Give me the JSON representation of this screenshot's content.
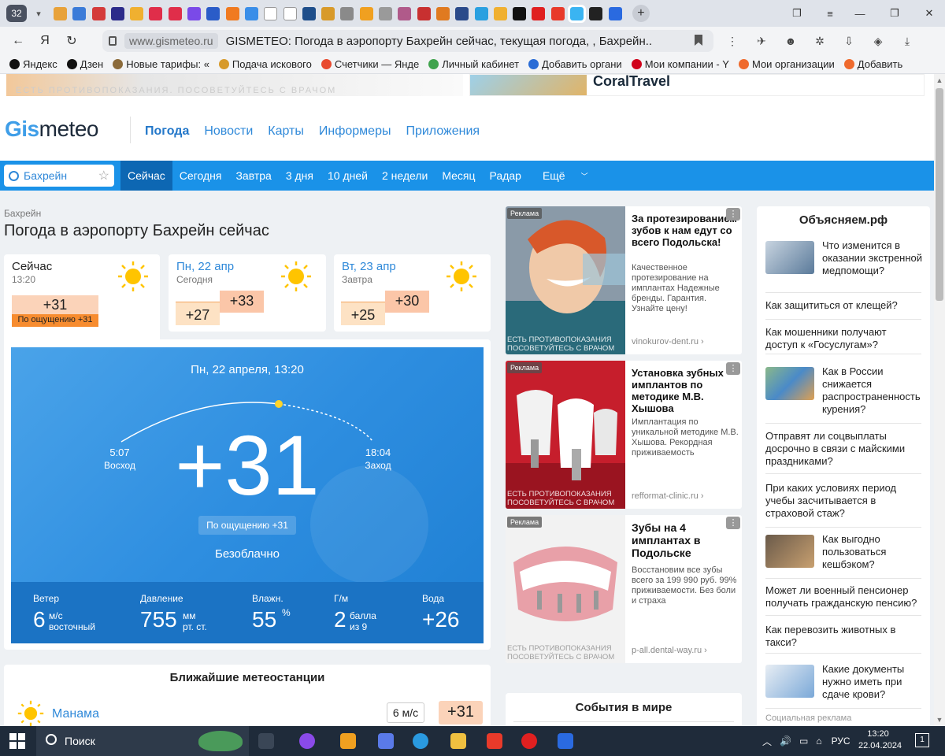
{
  "browser": {
    "tab_count": "32",
    "url_domain": "www.gismeteo.ru",
    "page_title": "GISMETEO: Погода в аэропорту Бахрейн сейчас, текущая погода, , Бахрейн...",
    "bookmarks": [
      {
        "label": "Яндекс",
        "color": "#111111"
      },
      {
        "label": "Дзен",
        "color": "#111111"
      },
      {
        "label": "Новые тарифы: «",
        "color": "#8b6a3a"
      },
      {
        "label": "Подача искового",
        "color": "#d79a2b"
      },
      {
        "label": "Счетчики — Янде",
        "color": "#e84a2f"
      },
      {
        "label": "Личный кабинет",
        "color": "#3fa34d"
      },
      {
        "label": "Добавить органи",
        "color": "#2a6cd6"
      },
      {
        "label": "Мои компании - Y",
        "color": "#d0021b"
      },
      {
        "label": "Мои организации",
        "color": "#ef6a2d"
      },
      {
        "label": "Добавить",
        "color": "#ef6a2d"
      }
    ]
  },
  "top_ad": {
    "left_disclaimer": "ЕСТЬ ПРОТИВОПОКАЗАНИЯ. ПОСОВЕТУЙТЕСЬ С ВРАЧОМ",
    "right_brand": "CoralTravel"
  },
  "header": {
    "logo_accent": "Gis",
    "logo_rest": "meteo",
    "nav": [
      "Погода",
      "Новости",
      "Карты",
      "Информеры",
      "Приложения"
    ]
  },
  "subnav": {
    "search_value": "Бахрейн",
    "items": [
      "Сейчас",
      "Сегодня",
      "Завтра",
      "3 дня",
      "10 дней",
      "2 недели",
      "Месяц",
      "Радар",
      "Ещё"
    ]
  },
  "page": {
    "breadcrumb": "Бахрейн",
    "title": "Погода в аэропорту Бахрейн сейчас"
  },
  "cards": {
    "now": {
      "title": "Сейчас",
      "time": "13:20",
      "temp": "+31",
      "feels": "По ощущению +31"
    },
    "today": {
      "title": "Пн, 22 апр",
      "sub": "Сегодня",
      "low": "+27",
      "high": "+33"
    },
    "tomorrow": {
      "title": "Вт, 23 апр",
      "sub": "Завтра",
      "low": "+25",
      "high": "+30"
    }
  },
  "current": {
    "datetime": "Пн, 22 апреля, 13:20",
    "sunrise_time": "5:07",
    "sunrise_label": "Восход",
    "sunset_time": "18:04",
    "sunset_label": "Заход",
    "temp": "+31",
    "feels": "По ощущению +31",
    "condition": "Безоблачно",
    "stats": {
      "wind_label": "Ветер",
      "wind_value": "6",
      "wind_unit": "м/с",
      "wind_dir": "восточный",
      "pressure_label": "Давление",
      "pressure_value": "755",
      "pressure_unit": "мм",
      "pressure_unit2": "рт. ст.",
      "humidity_label": "Влажн.",
      "humidity_value": "55",
      "humidity_unit": "%",
      "geo_label": "Г/м",
      "geo_value": "2",
      "geo_unit": "балла",
      "geo_unit2": "из 9",
      "water_label": "Вода",
      "water_value": "+26"
    }
  },
  "stations": {
    "title": "Ближайшие метеостанции",
    "first_name": "Манама",
    "first_wind": "6 м/с",
    "first_temp": "+31"
  },
  "ads": [
    {
      "label": "Реклама",
      "title": "За протезированием зубов к нам едут со всего Подольска!",
      "body": "Качественное протезирование на имплантах Надежные бренды. Гарантия. Узнайте цену!",
      "domain": "vinokurov-dent.ru ›",
      "warning": "ЕСТЬ ПРОТИВОПОКАЗАНИЯ ПОСОВЕТУЙТЕСЬ С ВРАЧОМ"
    },
    {
      "label": "Реклама",
      "title": "Установка зубных имплантов по методике М.В. Хышова",
      "body": "Имплантация по уникальной методике М.В. Хышова. Рекордная приживаемость",
      "domain": "refformat-clinic.ru ›",
      "warning": "ЕСТЬ ПРОТИВОПОКАЗАНИЯ ПОСОВЕТУЙТЕСЬ С ВРАЧОМ"
    },
    {
      "label": "Реклама",
      "title": "Зубы на 4 имплантах в Подольске",
      "body": "Восстановим все зубы всего за 199 990 руб. 99% приживаемости. Без боли и страха",
      "domain": "p-all.dental-way.ru ›",
      "warning": "ЕСТЬ ПРОТИВОПОКАЗАНИЯ ПОСОВЕТУЙТЕСЬ С ВРАЧОМ"
    }
  ],
  "events": {
    "title": "События в мире"
  },
  "explain": {
    "title": "Объясняем.рф",
    "items": [
      "Что изменится в оказании экстренной медпомощи?",
      "Как защититься от клещей?",
      "Как мошенники получают доступ к «Госуслугам»?",
      "Как в России снижается распространенность курения?",
      "Отправят ли соцвыплаты досрочно в связи с майскими праздниками?",
      "При каких условиях период учебы засчитывается в страховой стаж?",
      "Как выгодно пользоваться кешбэком?",
      "Может ли военный пенсионер получать гражданскую пенсию?",
      "Как перевозить животных в такси?",
      "Какие документы нужно иметь при сдаче крови?"
    ],
    "footer": "Социальная реклама"
  },
  "taskbar": {
    "search_label": "Поиск",
    "lang": "РУС",
    "time": "13:20",
    "date": "22.04.2024",
    "notif": "1"
  }
}
